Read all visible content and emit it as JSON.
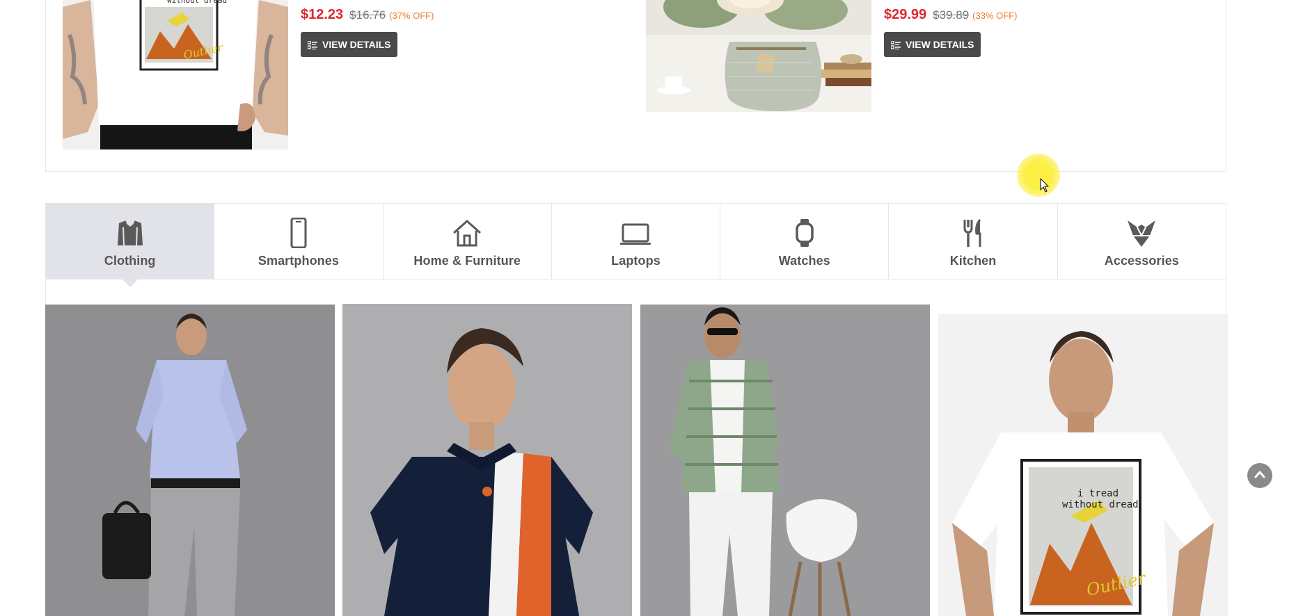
{
  "deals": [
    {
      "image_alt": "white graphic t-shirt",
      "price": "$12.23",
      "old_price": "$16.76",
      "discount": "(37% OFF)",
      "button_label": "VIEW DETAILS",
      "print_text": "i tread without dread"
    },
    {
      "image_alt": "flower vase",
      "price": "$29.99",
      "old_price": "$39.89",
      "discount": "(33% OFF)",
      "button_label": "VIEW DETAILS"
    }
  ],
  "categories": [
    {
      "label": "Clothing",
      "icon": "clothing-icon",
      "active": true
    },
    {
      "label": "Smartphones",
      "icon": "smartphone-icon",
      "active": false
    },
    {
      "label": "Home & Furniture",
      "icon": "home-icon",
      "active": false
    },
    {
      "label": "Laptops",
      "icon": "laptop-icon",
      "active": false
    },
    {
      "label": "Watches",
      "icon": "watch-icon",
      "active": false
    },
    {
      "label": "Kitchen",
      "icon": "kitchen-icon",
      "active": false
    },
    {
      "label": "Accessories",
      "icon": "accessories-icon",
      "active": false
    }
  ],
  "products": [
    {
      "image_alt": "man in blue formal shirt and grey trousers"
    },
    {
      "image_alt": "navy polo with orange and white stripe"
    },
    {
      "image_alt": "green checked shirt and white trousers"
    },
    {
      "image_alt": "white graphic t-shirt",
      "print_text": "i tread without dread"
    }
  ],
  "colors": {
    "price": "#e0262f",
    "discount": "#ee7a2a",
    "button_bg": "#4a4a4a",
    "active_tab_bg": "#e1e3e8",
    "scroll_top_bg": "#8a8a8a"
  },
  "scroll_top_icon": "chevron-up-icon"
}
